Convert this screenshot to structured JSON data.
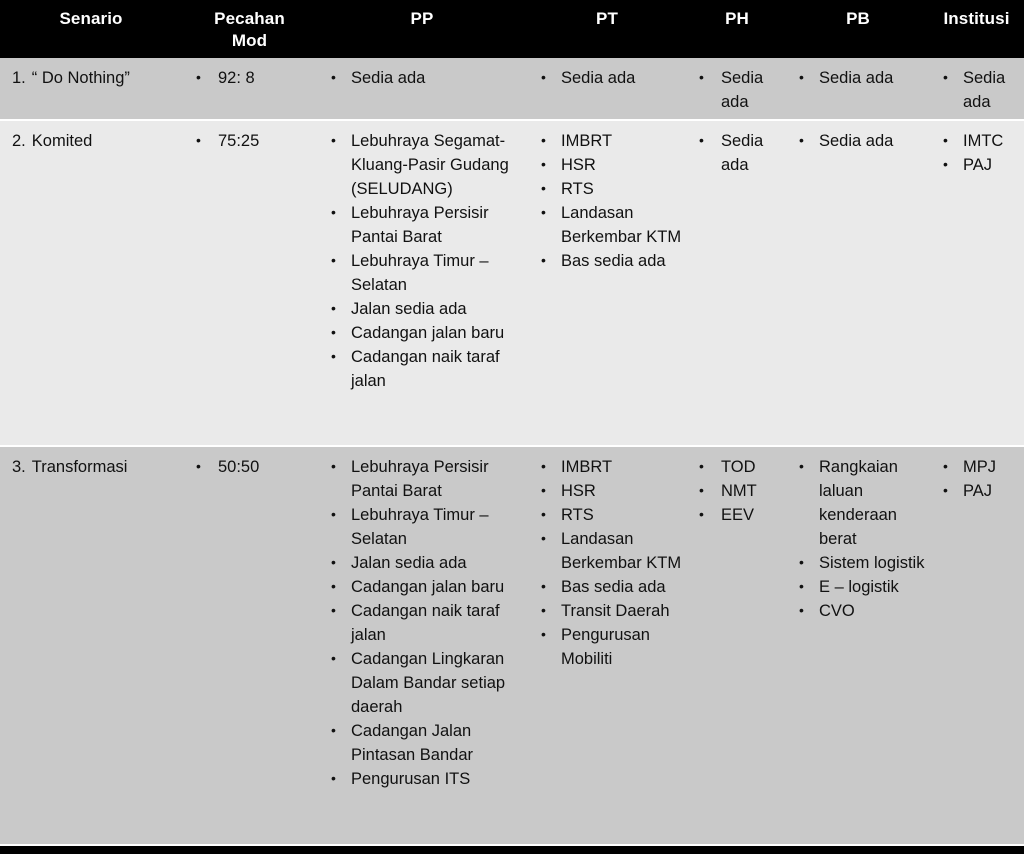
{
  "table": {
    "columns": [
      {
        "key": "senario",
        "label": "Senario"
      },
      {
        "key": "pecahan",
        "label": "Pecahan Mod"
      },
      {
        "key": "pp",
        "label": "PP"
      },
      {
        "key": "pt",
        "label": "PT"
      },
      {
        "key": "ph",
        "label": "PH"
      },
      {
        "key": "pb",
        "label": "PB"
      },
      {
        "key": "institusi",
        "label": "Institusi"
      }
    ],
    "header": {
      "senario": "Senario",
      "pecahan_line1": "Pecahan",
      "pecahan_line2": "Mod",
      "pp": "PP",
      "pt": "PT",
      "ph": "PH",
      "pb": "PB",
      "institusi": "Institusi"
    },
    "rows": [
      {
        "number": "1.",
        "senario": "“ Do Nothing”",
        "pecahan": [
          "92: 8"
        ],
        "pp": [
          "Sedia ada"
        ],
        "pt": [
          "Sedia ada"
        ],
        "ph": [
          "Sedia ada"
        ],
        "pb": [
          "Sedia ada"
        ],
        "institusi": [
          "Sedia ada"
        ],
        "shade": "dark"
      },
      {
        "number": "2.",
        "senario": "Komited",
        "pecahan": [
          "75:25"
        ],
        "pp": [
          "Lebuhraya Segamat-Kluang-Pasir Gudang (SELUDANG)",
          "Lebuhraya Persisir Pantai Barat",
          "Lebuhraya Timur – Selatan",
          "Jalan  sedia  ada",
          "Cadangan  jalan baru",
          "Cadangan naik taraf jalan"
        ],
        "pt": [
          "IMBRT",
          "HSR",
          "RTS",
          "Landasan Berkembar KTM",
          "Bas sedia ada"
        ],
        "ph": [
          "Sedia ada"
        ],
        "pb": [
          "Sedia ada"
        ],
        "institusi": [
          "IMTC",
          "PAJ"
        ],
        "shade": "light"
      },
      {
        "number": "3.",
        "senario": "Transformasi",
        "pecahan": [
          "50:50"
        ],
        "pp": [
          "Lebuhraya Persisir Pantai Barat",
          "Lebuhraya Timur – Selatan",
          "Jalan  sedia  ada",
          "Cadangan jalan baru",
          "Cadangan naik taraf jalan",
          "Cadangan Lingkaran Dalam Bandar setiap daerah",
          "Cadangan Jalan Pintasan Bandar",
          "Pengurusan  ITS"
        ],
        "pt": [
          "IMBRT",
          "HSR",
          "RTS",
          "Landasan Berkembar KTM",
          "Bas sedia ada",
          "Transit Daerah",
          "Pengurusan Mobiliti"
        ],
        "ph": [
          "TOD",
          "NMT",
          "EEV"
        ],
        "pb": [
          "Rangkaian laluan kenderaan berat",
          "Sistem logistik",
          "E – logistik",
          "CVO"
        ],
        "institusi": [
          "MPJ",
          "PAJ"
        ],
        "shade": "dark"
      }
    ]
  },
  "colors": {
    "header_bg": "#000000",
    "header_text": "#ffffff",
    "row_dark": "#c9c9c9",
    "row_light": "#eaeaea",
    "body_text": "#111111",
    "separator": "#ffffff"
  }
}
